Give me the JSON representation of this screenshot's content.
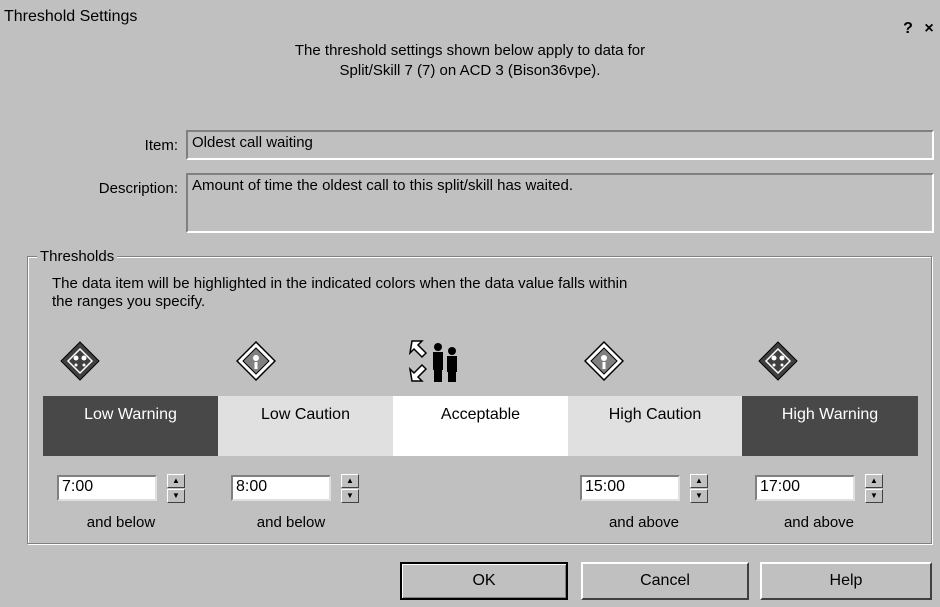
{
  "window": {
    "title": "Threshold Settings",
    "help_glyph": "?",
    "close_glyph": "×"
  },
  "intro": {
    "line1": "The threshold settings shown below apply to data for",
    "line2": "Split/Skill 7 (7) on ACD 3 (Bison36vpe)."
  },
  "item": {
    "label": "Item:",
    "value": "Oldest call waiting"
  },
  "description": {
    "label": "Description:",
    "value": "Amount of time the oldest call to this split/skill has waited."
  },
  "thresholds": {
    "group_title": "Thresholds",
    "text_line1": "The data item will be highlighted in the indicated colors when the data value falls within",
    "text_line2": "the ranges you specify.",
    "bands": [
      {
        "label": "Low Warning",
        "color": "#484848",
        "text_color": "#ffffff"
      },
      {
        "label": "Low Caution",
        "color": "#e0e0e0",
        "text_color": "#000000"
      },
      {
        "label": "Acceptable",
        "color": "#ffffff",
        "text_color": "#000000"
      },
      {
        "label": "High Caution",
        "color": "#e0e0e0",
        "text_color": "#000000"
      },
      {
        "label": "High Warning",
        "color": "#484848",
        "text_color": "#ffffff"
      }
    ],
    "values": [
      {
        "value": "7:00",
        "sublabel": "and below"
      },
      {
        "value": "8:00",
        "sublabel": "and below"
      },
      {
        "value": "15:00",
        "sublabel": "and above"
      },
      {
        "value": "17:00",
        "sublabel": "and above"
      }
    ],
    "icons": [
      "warning-diamond-icon",
      "caution-diamond-icon",
      "acceptable-people-icon",
      "caution-diamond-icon",
      "warning-diamond-icon"
    ]
  },
  "buttons": {
    "ok": "OK",
    "cancel": "Cancel",
    "help": "Help"
  }
}
